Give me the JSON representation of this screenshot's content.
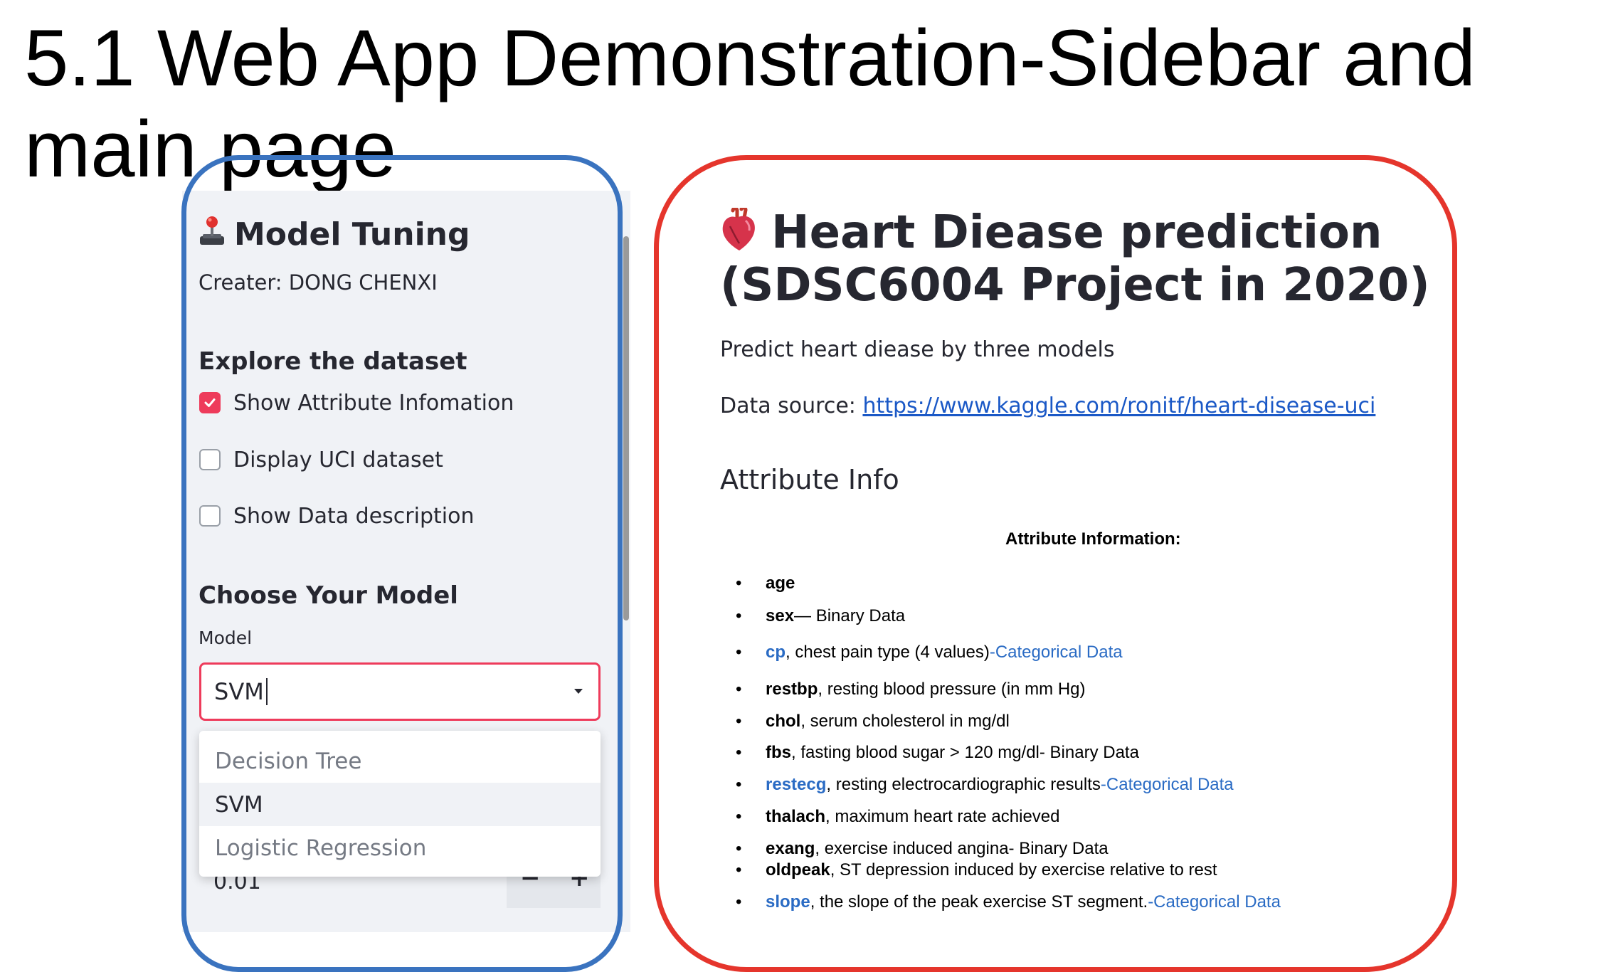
{
  "slide": {
    "title": "5.1 Web App Demonstration-Sidebar and main page"
  },
  "sidebar": {
    "title": "Model Tuning",
    "creator": "Creater: DONG CHENXI",
    "explore_heading": "Explore the dataset",
    "checkboxes": [
      {
        "label": "Show Attribute Infomation",
        "checked": true
      },
      {
        "label": "Display UCI dataset",
        "checked": false
      },
      {
        "label": "Show Data description",
        "checked": false
      }
    ],
    "model_heading": "Choose Your Model",
    "model_label": "Model",
    "model_value": "SVM",
    "dropdown_options": [
      {
        "label": "Decision Tree",
        "selected": false
      },
      {
        "label": "SVM",
        "selected": true
      },
      {
        "label": "Logistic Regression",
        "selected": false
      }
    ],
    "number_input_value": "0.01",
    "number_minus": "−",
    "number_plus": "+"
  },
  "main": {
    "title": "Heart Diease prediction (SDSC6004 Project in 2020)",
    "subtitle": "Predict heart diease by three models",
    "data_source_label": "Data source: ",
    "data_source_url": "https://www.kaggle.com/ronitf/heart-disease-uci",
    "attr_heading": "Attribute Info",
    "attr_subtitle": "Attribute Information:",
    "attributes": [
      {
        "name": "age",
        "desc": "",
        "cat": "",
        "blue": false
      },
      {
        "name": "sex",
        "desc": "— Binary Data",
        "cat": "",
        "blue": false
      },
      {
        "name": "cp",
        "desc": ", chest pain type (4 values)",
        "cat": "-Categorical Data",
        "blue": true
      },
      {
        "name": "restbp",
        "desc": ", resting blood pressure (in mm Hg)",
        "cat": "",
        "blue": false
      },
      {
        "name": "chol",
        "desc": ", serum cholesterol in mg/dl",
        "cat": "",
        "blue": false
      },
      {
        "name": "fbs",
        "desc": ", fasting blood sugar > 120 mg/dl- Binary Data",
        "cat": "",
        "blue": false
      },
      {
        "name": "restecg",
        "desc": ", resting electrocardiographic results",
        "cat": "-Categorical Data",
        "blue": true
      },
      {
        "name": "thalach",
        "desc": ", maximum heart rate achieved",
        "cat": "",
        "blue": false
      },
      {
        "name": "exang",
        "desc": ", exercise induced angina- Binary Data",
        "cat": "",
        "blue": false
      },
      {
        "name": "oldpeak",
        "desc": ", ST depression induced by exercise relative to rest",
        "cat": "",
        "blue": false
      },
      {
        "name": "slope",
        "desc": ", the slope of the peak exercise ST segment.",
        "cat": "-Categorical Data",
        "blue": true
      }
    ]
  },
  "colors": {
    "accent": "#ee3b5b",
    "link": "#1a58c6",
    "outline_blue": "#3a73bf",
    "outline_red": "#e5352c"
  }
}
